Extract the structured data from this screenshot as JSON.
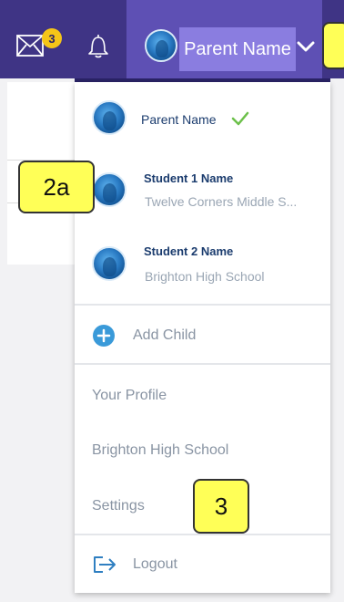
{
  "header": {
    "mail_badge": "3",
    "user_name": "Parent Name"
  },
  "accounts": [
    {
      "name": "Parent Name",
      "subtitle": "",
      "selected": true
    },
    {
      "name": "Student 1 Name",
      "subtitle": "Twelve Corners Middle S..."
    },
    {
      "name": "Student 2 Name",
      "subtitle": "Brighton High School"
    }
  ],
  "menu": {
    "add_child": "Add Child",
    "your_profile": "Your Profile",
    "school": "Brighton High School",
    "settings": "Settings",
    "logout": "Logout"
  },
  "callouts": {
    "a": "2a",
    "b": "3"
  },
  "colors": {
    "topbar": "#3f3485",
    "active": "#5e50b4",
    "callout": "#ffff57",
    "check": "#6cc04a",
    "accent_blue": "#3a9ad9"
  }
}
